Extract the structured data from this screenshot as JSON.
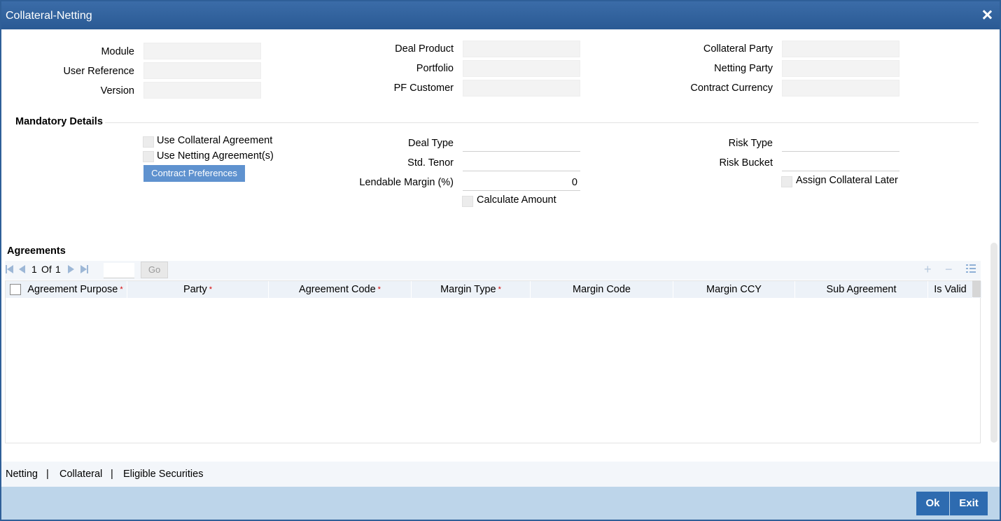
{
  "window": {
    "title": "Collateral-Netting"
  },
  "header_fields": {
    "module_label": "Module",
    "user_reference_label": "User Reference",
    "version_label": "Version",
    "deal_product_label": "Deal Product",
    "portfolio_label": "Portfolio",
    "pf_customer_label": "PF Customer",
    "collateral_party_label": "Collateral Party",
    "netting_party_label": "Netting Party",
    "contract_currency_label": "Contract Currency"
  },
  "mandatory": {
    "section_title": "Mandatory Details",
    "use_collateral_agreement": "Use Collateral Agreement",
    "use_netting_agreements": "Use Netting Agreement(s)",
    "contract_preferences": "Contract Preferences",
    "deal_type_label": "Deal Type",
    "std_tenor_label": "Std. Tenor",
    "lendable_margin_label": "Lendable Margin (%)",
    "lendable_margin_value": "0",
    "calculate_amount": "Calculate Amount",
    "risk_type_label": "Risk Type",
    "risk_bucket_label": "Risk Bucket",
    "assign_collateral_later": "Assign Collateral Later"
  },
  "agreements": {
    "section_title": "Agreements",
    "pagination": {
      "current": "1",
      "of": "Of",
      "total": "1"
    },
    "go_label": "Go",
    "columns": [
      {
        "label": "Agreement Purpose",
        "required": "*"
      },
      {
        "label": "Party",
        "required": "*"
      },
      {
        "label": "Agreement Code",
        "required": "*"
      },
      {
        "label": "Margin Type",
        "required": "*"
      },
      {
        "label": "Margin Code",
        "required": ""
      },
      {
        "label": "Margin CCY",
        "required": ""
      },
      {
        "label": "Sub Agreement",
        "required": ""
      },
      {
        "label": "Is Valid",
        "required": ""
      }
    ]
  },
  "bottom_links": {
    "netting": "Netting",
    "sep": "|",
    "collateral": "Collateral",
    "eligible_securities": "Eligible Securities"
  },
  "footer": {
    "ok": "Ok",
    "exit": "Exit"
  },
  "icons": [
    "close-icon",
    "first-page-icon",
    "previous-page-icon",
    "next-page-icon",
    "last-page-icon",
    "add-row-icon",
    "delete-row-icon",
    "single-record-view-icon"
  ]
}
